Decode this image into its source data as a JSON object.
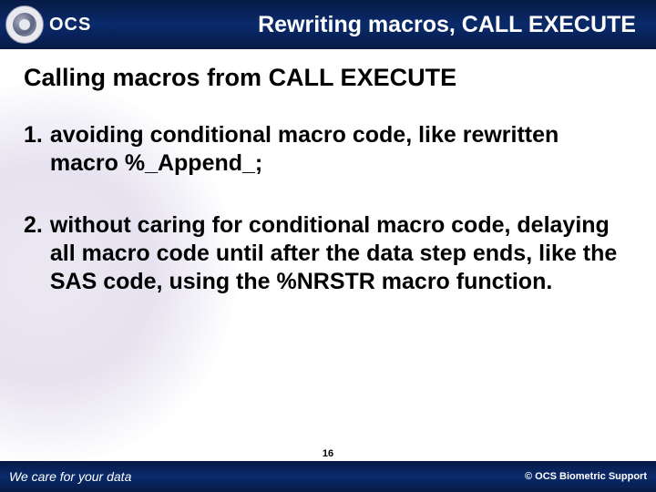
{
  "header": {
    "logo_text": "OCS",
    "title": "Rewriting macros, CALL EXECUTE"
  },
  "content": {
    "subtitle": "Calling macros from CALL EXECUTE",
    "items": [
      {
        "num": "1.",
        "text": "avoiding conditional macro code, like rewritten macro %_Append_;"
      },
      {
        "num": "2.",
        "text": "without caring for conditional macro code, delaying all macro code until after the data step ends, like the SAS code, using the %NRSTR macro function."
      }
    ]
  },
  "footer": {
    "tagline": "We care for your data",
    "page": "16",
    "copyright": "© OCS Biometric Support"
  }
}
